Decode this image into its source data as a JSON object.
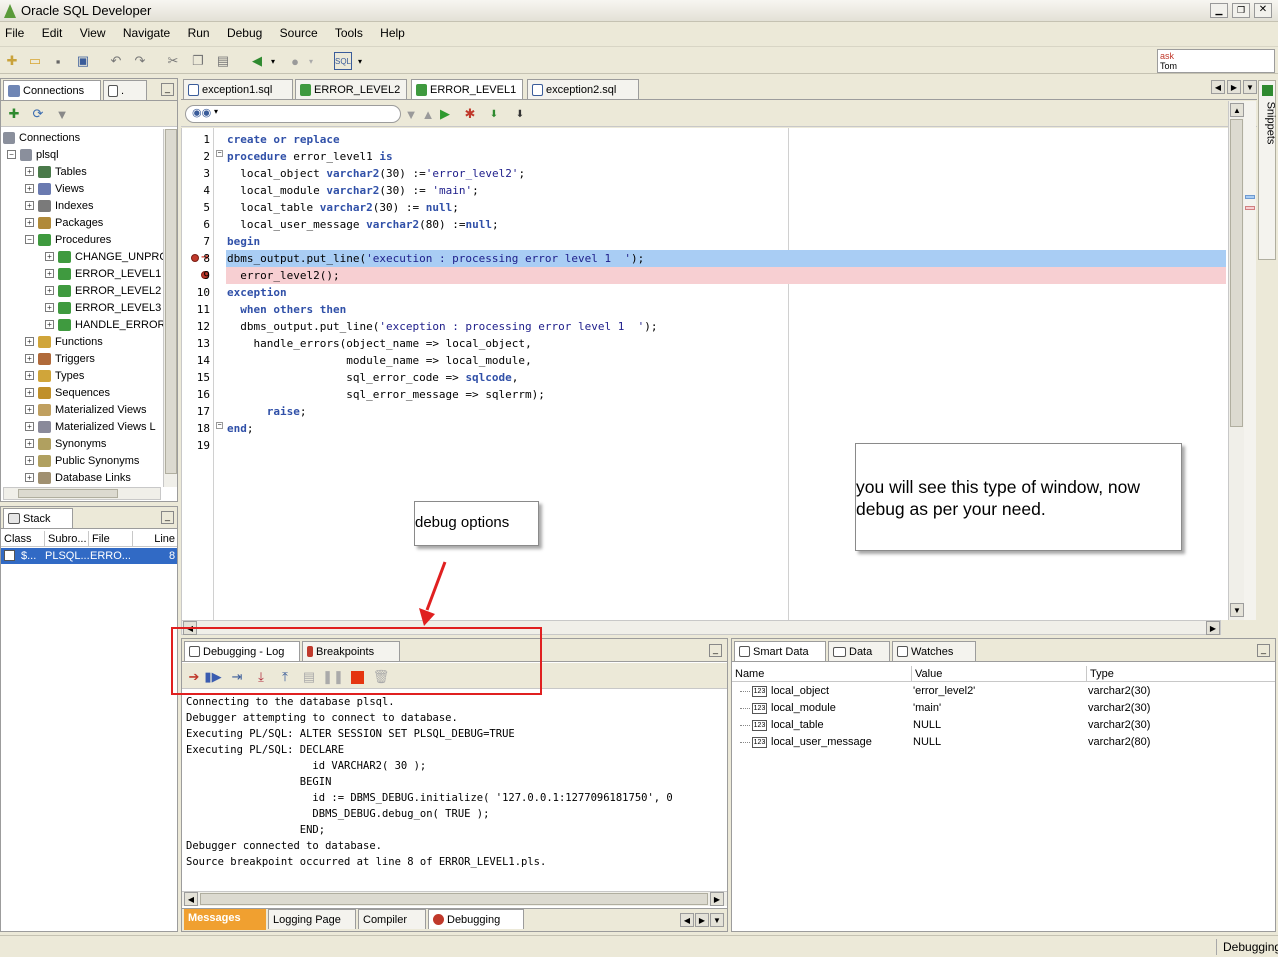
{
  "window": {
    "title": "Oracle SQL Developer"
  },
  "menu": [
    "File",
    "Edit",
    "View",
    "Navigate",
    "Run",
    "Debug",
    "Source",
    "Tools",
    "Help"
  ],
  "ask_tom": {
    "line1": "ask",
    "line2": "Tom"
  },
  "left_panel": {
    "tab_connections": "Connections",
    "tab_reports": ".",
    "tree": {
      "root": "Connections",
      "connection": "plsql",
      "nodes": [
        "Tables",
        "Views",
        "Indexes",
        "Packages",
        "Procedures"
      ],
      "procedures": [
        "CHANGE_UNPRO",
        "ERROR_LEVEL1",
        "ERROR_LEVEL2",
        "ERROR_LEVEL3",
        "HANDLE_ERROR"
      ],
      "more_nodes": [
        "Functions",
        "Triggers",
        "Types",
        "Sequences",
        "Materialized Views",
        "Materialized Views L",
        "Synonyms",
        "Public Synonyms",
        "Database Links"
      ]
    }
  },
  "stack_panel": {
    "title": "Stack",
    "columns": [
      "Class",
      "Subro...",
      "File",
      "Line"
    ],
    "row": {
      "class": "$...",
      "subro": "PLSQL...",
      "file": "ERRO...",
      "line": "8"
    }
  },
  "editor": {
    "tabs": [
      "exception1.sql",
      "ERROR_LEVEL2",
      "ERROR_LEVEL1",
      "exception2.sql"
    ],
    "line_numbers": [
      "1",
      "2",
      "3",
      "4",
      "5",
      "6",
      "7",
      "8",
      "9",
      "10",
      "11",
      "12",
      "13",
      "14",
      "15",
      "16",
      "17",
      "18",
      "19"
    ],
    "lines": [
      "create or replace",
      "procedure error_level1 is",
      "  local_object varchar2(30) :='error_level2';",
      "  local_module varchar2(30) := 'main';",
      "  local_table varchar2(30) := null;",
      "  local_user_message varchar2(80) :=null;",
      "begin",
      "dbms_output.put_line('execution : processing error level 1  ');",
      "  error_level2();",
      "exception",
      "  when others then",
      "  dbms_output.put_line('exception : processing error level 1  ');",
      "    handle_errors(object_name => local_object,",
      "                  module_name => local_module,",
      "                  sql_error_code => sqlcode,",
      "                  sql_error_message => sqlerrm);",
      "      raise;",
      "end;",
      ""
    ]
  },
  "annotations": {
    "debug_options": "debug options",
    "window_note": "you will see this type of window, now debug as per your need."
  },
  "log_panel": {
    "tab_log": "Debugging - Log",
    "tab_breakpoints": "Breakpoints",
    "lines": [
      "Connecting to the database plsql.",
      "Debugger attempting to connect to database.",
      "Executing PL/SQL: ALTER SESSION SET PLSQL_DEBUG=TRUE",
      "Executing PL/SQL: DECLARE",
      "                    id VARCHAR2( 30 );",
      "                  BEGIN",
      "                    id := DBMS_DEBUG.initialize( '127.0.0.1:1277096181750', 0",
      "                    DBMS_DEBUG.debug_on( TRUE );",
      "                  END;",
      "Debugger connected to database.",
      "Source breakpoint occurred at line 8 of ERROR_LEVEL1.pls."
    ],
    "bottom_tabs": [
      "Messages",
      "Logging Page",
      "Compiler",
      "Debugging"
    ]
  },
  "data_panel": {
    "tabs": [
      "Smart Data",
      "Data",
      "Watches"
    ],
    "columns": [
      "Name",
      "Value",
      "Type"
    ],
    "rows": [
      {
        "name": "local_object",
        "value": "'error_level2'",
        "type": "varchar2(30)"
      },
      {
        "name": "local_module",
        "value": "'main'",
        "type": "varchar2(30)"
      },
      {
        "name": "local_table",
        "value": "NULL",
        "type": "varchar2(30)"
      },
      {
        "name": "local_user_message",
        "value": "NULL",
        "type": "varchar2(80)"
      }
    ]
  },
  "snippets": {
    "label": "Snippets"
  },
  "status": {
    "text": "Debugging"
  }
}
